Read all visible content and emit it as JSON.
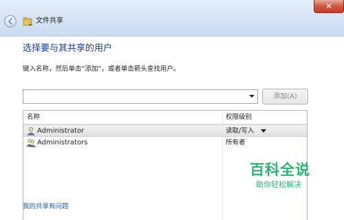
{
  "window": {
    "title": "文件共享",
    "close_glyph": "✕"
  },
  "dialog": {
    "heading": "选择要与其共享的用户",
    "instruction": "键入名称，然后单击“添加”，或者单击箭头查找用户。",
    "name_input": {
      "value": "",
      "placeholder": ""
    },
    "add_button_label": "添加(A)",
    "columns": {
      "name": "名称",
      "permission": "权限级别"
    },
    "rows": [
      {
        "name": "Administrator",
        "permission": "读取/写入",
        "selected": true,
        "icon": "user-icon"
      },
      {
        "name": "Administrators",
        "permission": "所有者",
        "selected": false,
        "icon": "group-icon"
      }
    ],
    "help_link": "我的共享有问题"
  },
  "watermark": {
    "title": "百科全说",
    "subtitle": "助你轻松解决"
  },
  "colors": {
    "heading": "#1a3d8f",
    "link": "#1a5bb5",
    "watermark": "#2bb574",
    "close": "#c23d23"
  }
}
